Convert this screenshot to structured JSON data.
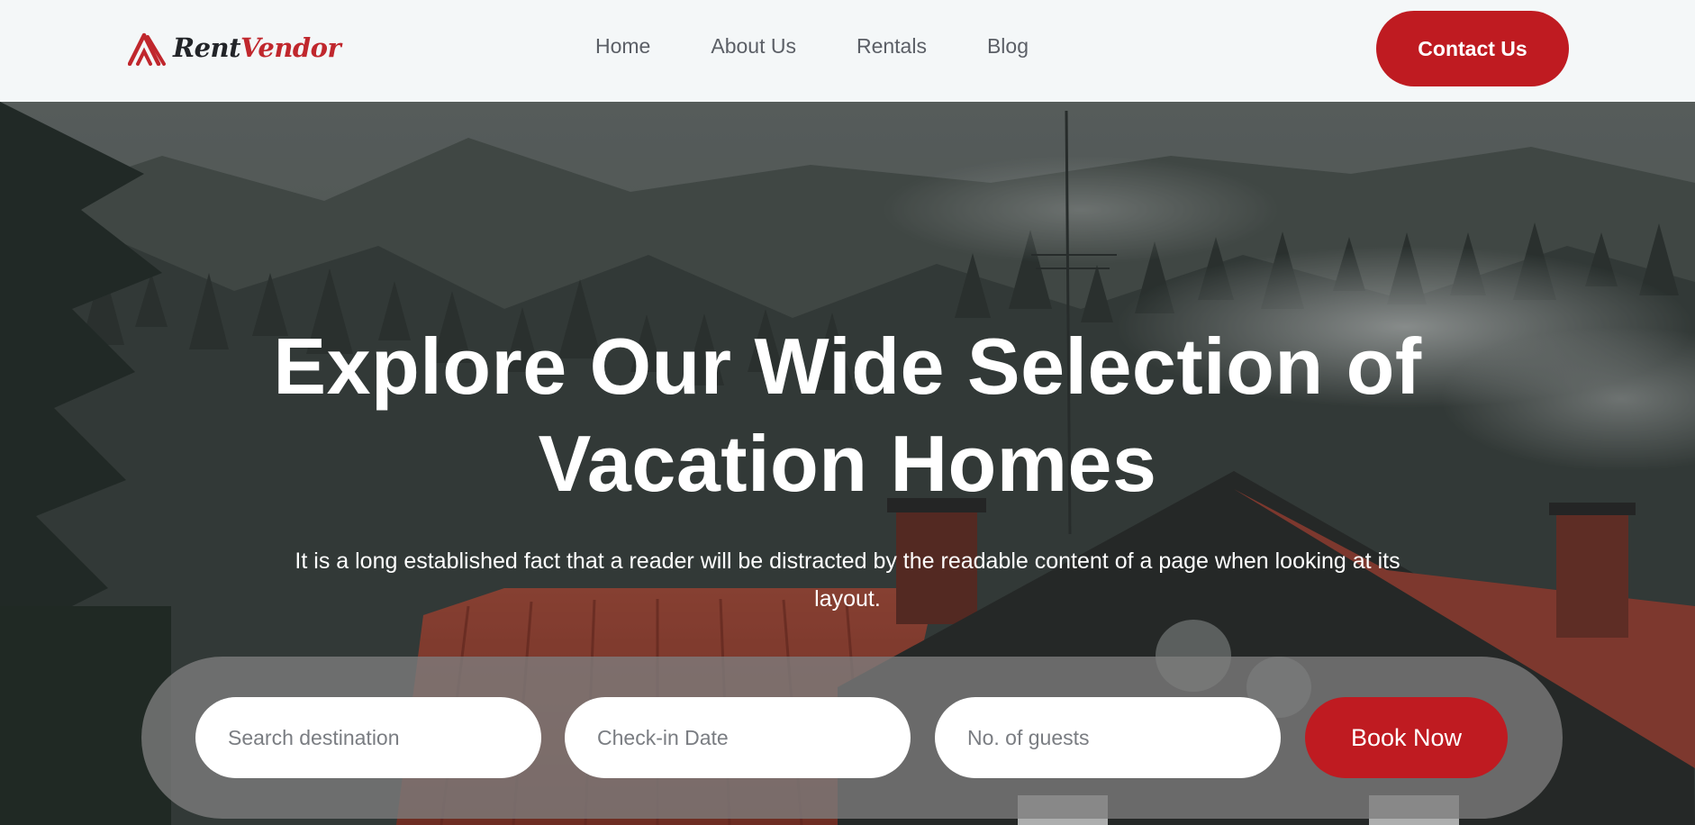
{
  "brand": {
    "name_part1": "Rent",
    "name_part2": "Vendor",
    "logo_icon": "house-roof-icon",
    "accent_color": "#bf1b21"
  },
  "nav": {
    "items": [
      {
        "label": "Home"
      },
      {
        "label": "About Us"
      },
      {
        "label": "Rentals"
      },
      {
        "label": "Blog"
      }
    ],
    "contact_label": "Contact Us"
  },
  "hero": {
    "title_line1": "Explore Our Wide Selection of",
    "title_line2": "Vacation Homes",
    "subtitle": "It is a long established fact that a reader will be distracted by the readable content of a page when looking at its layout."
  },
  "booking": {
    "destination_placeholder": "Search destination",
    "checkin_placeholder": "Check-in Date",
    "guests_placeholder": "No. of guests",
    "submit_label": "Book Now"
  }
}
